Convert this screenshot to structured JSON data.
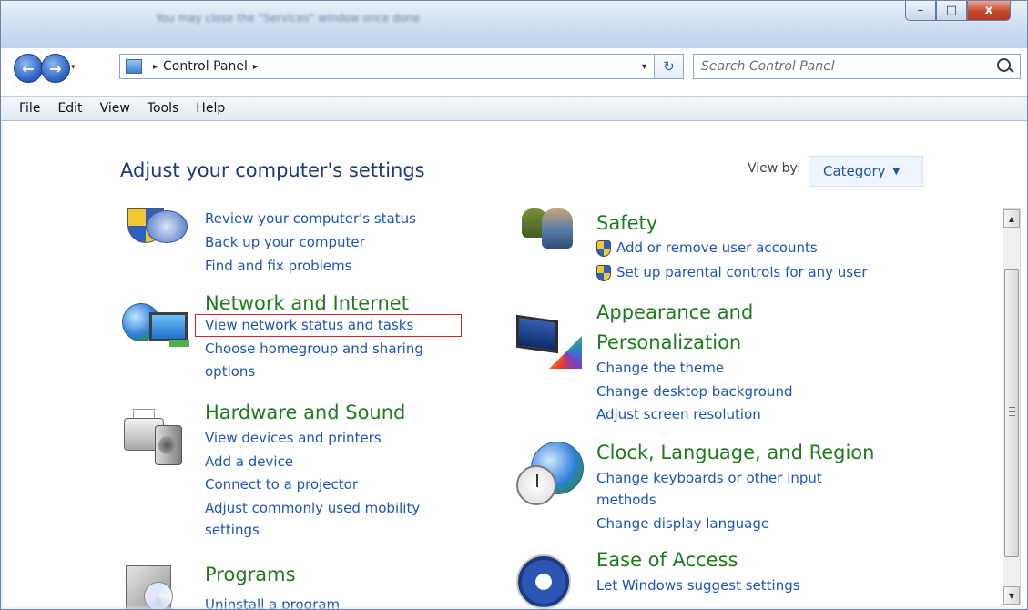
{
  "window": {
    "title_blurred": "You may close the \"Services\" window once done",
    "controls": {
      "minimize": "–",
      "maximize": "□",
      "close": "x"
    }
  },
  "navigation": {
    "back": "←",
    "forward": "→",
    "recent": "▾",
    "breadcrumb_root_arrow": "▸",
    "breadcrumb": [
      "Control Panel"
    ],
    "breadcrumb_trailing_arrow": "▸",
    "address_dropdown": "▾",
    "refresh": "↻",
    "search_placeholder": "Search Control Panel"
  },
  "menu": [
    "File",
    "Edit",
    "View",
    "Tools",
    "Help"
  ],
  "content": {
    "heading": "Adjust your computer's settings",
    "view_by_label": "View by:",
    "view_by_value": "Category",
    "view_by_caret": "▼"
  },
  "categories": {
    "system": {
      "links": [
        "Review your computer's status",
        "Back up your computer",
        "Find and fix problems"
      ]
    },
    "network": {
      "title": "Network and Internet",
      "links": [
        "View network status and tasks",
        "Choose homegroup and sharing",
        "options"
      ]
    },
    "hardware": {
      "title": "Hardware and Sound",
      "links": [
        "View devices and printers",
        "Add a device",
        "Connect to a projector",
        "Adjust commonly used mobility",
        "settings"
      ]
    },
    "programs": {
      "title": "Programs",
      "links": [
        "Uninstall a program"
      ]
    },
    "safety": {
      "title": "Safety",
      "links": [
        "Add or remove user accounts",
        "Set up parental controls for any user"
      ]
    },
    "appearance": {
      "title_line1": "Appearance and",
      "title_line2": "Personalization",
      "links": [
        "Change the theme",
        "Change desktop background",
        "Adjust screen resolution"
      ]
    },
    "clock": {
      "title": "Clock, Language, and Region",
      "links": [
        "Change keyboards or other input",
        "methods",
        "Change display language"
      ]
    },
    "ease": {
      "title": "Ease of Access",
      "links": [
        "Let Windows suggest settings"
      ]
    }
  },
  "scrollbar": {
    "up": "▲",
    "down": "▼"
  },
  "colors": {
    "link": "#1c55b8",
    "category_title": "#1d7c1d",
    "heading": "#1d3b7a",
    "highlight": "#d3242b"
  }
}
